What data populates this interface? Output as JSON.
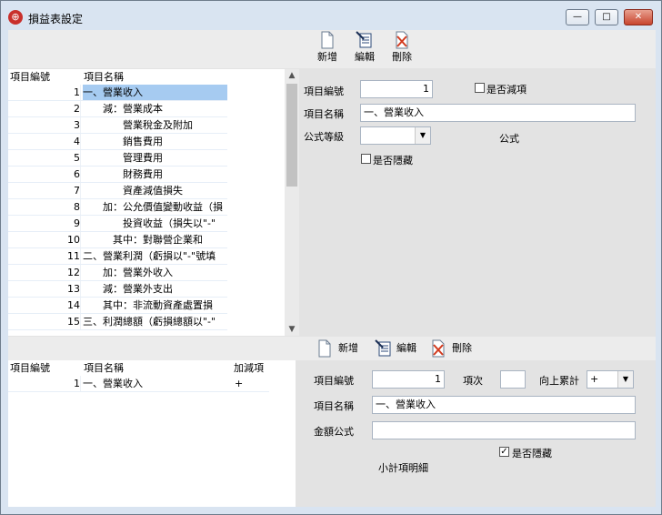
{
  "window": {
    "title": "損益表設定",
    "minimize_glyph": "—",
    "maximize_glyph": "□",
    "close_glyph": "✕"
  },
  "top_toolbar": {
    "add_label": "新增",
    "edit_label": "編輯",
    "delete_label": "刪除"
  },
  "top_list": {
    "columns": [
      "項目編號",
      "項目名稱"
    ],
    "rows": [
      {
        "num": "1",
        "name": "一、營業收入"
      },
      {
        "num": "2",
        "name": "　　減：營業成本"
      },
      {
        "num": "3",
        "name": "　　　　營業稅金及附加"
      },
      {
        "num": "4",
        "name": "　　　　銷售費用"
      },
      {
        "num": "5",
        "name": "　　　　管理費用"
      },
      {
        "num": "6",
        "name": "　　　　財務費用"
      },
      {
        "num": "7",
        "name": "　　　　資產減值損失"
      },
      {
        "num": "8",
        "name": "　　加：公允價值變動收益（損"
      },
      {
        "num": "9",
        "name": "　　　　投資收益（損失以\"-\""
      },
      {
        "num": "10",
        "name": "　　　其中：對聯營企業和"
      },
      {
        "num": "11",
        "name": "二、營業利潤（虧損以\"-\"號填"
      },
      {
        "num": "12",
        "name": "　　加：營業外收入"
      },
      {
        "num": "13",
        "name": "　　減：營業外支出"
      },
      {
        "num": "14",
        "name": "　　其中：非流動資產處置損"
      },
      {
        "num": "15",
        "name": "三、利潤總額（虧損總額以\"-\""
      }
    ]
  },
  "top_form": {
    "item_no_label": "項目編號",
    "item_no_value": "1",
    "is_deduct_label": "是否減項",
    "item_name_label": "項目名稱",
    "item_name_value": "一、營業收入",
    "formula_level_label": "公式等級",
    "formula_level_value": "",
    "formula_label": "公式",
    "is_hidden_label": "是否隱藏"
  },
  "bottom_toolbar": {
    "add_label": "新增",
    "edit_label": "編輯",
    "delete_label": "刪除"
  },
  "bottom_list": {
    "columns": [
      "項目編號",
      "項目名稱",
      "加減項"
    ],
    "rows": [
      {
        "num": "1",
        "name": "一、營業收入",
        "sign": "+"
      }
    ]
  },
  "bottom_form": {
    "item_no_label": "項目編號",
    "item_no_value": "1",
    "order_label": "項次",
    "order_value": "",
    "upward_label": "向上累計",
    "upward_value": "+",
    "item_name_label": "項目名稱",
    "item_name_value": "一、營業收入",
    "amount_formula_label": "金額公式",
    "amount_formula_value": "",
    "is_hidden_label": "是否隱藏",
    "is_hidden_checked": "✓",
    "subtotal_label": "小計項明細"
  },
  "colors": {
    "selection": "#a6cbf1",
    "title_bar": "#d9e4f1",
    "close_button": "#c8452e"
  }
}
